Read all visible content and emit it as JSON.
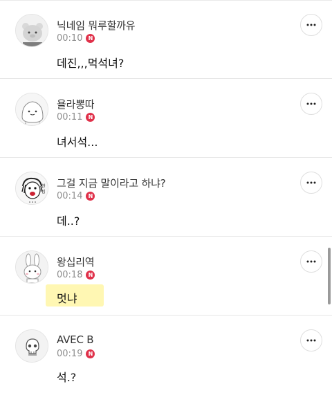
{
  "comments": [
    {
      "avatar_icon": "bear-face-icon",
      "nickname": "닉네임 뭐루할까유",
      "time": "00:10",
      "badge": "N",
      "text": "데진,,,먹석녀?",
      "highlighted": false
    },
    {
      "avatar_icon": "dumpling-face-icon",
      "nickname": "욜라뽕따",
      "time": "00:11",
      "badge": "N",
      "text": "녀서석...",
      "highlighted": false
    },
    {
      "avatar_icon": "sketch-face-icon",
      "nickname": "그걸 지금 말이라고 하냐?",
      "time": "00:14",
      "badge": "N",
      "text": "데..?",
      "highlighted": false
    },
    {
      "avatar_icon": "bunny-face-icon",
      "nickname": "왕십리역",
      "time": "00:18",
      "badge": "N",
      "text": "멋냐",
      "highlighted": true
    },
    {
      "avatar_icon": "skull-face-icon",
      "nickname": "AVEC B",
      "time": "00:19",
      "badge": "N",
      "text": "석.?",
      "highlighted": false
    }
  ],
  "colors": {
    "badge": "#e0314a",
    "highlight": "#fff7b3",
    "divider": "#e6e6e6"
  }
}
